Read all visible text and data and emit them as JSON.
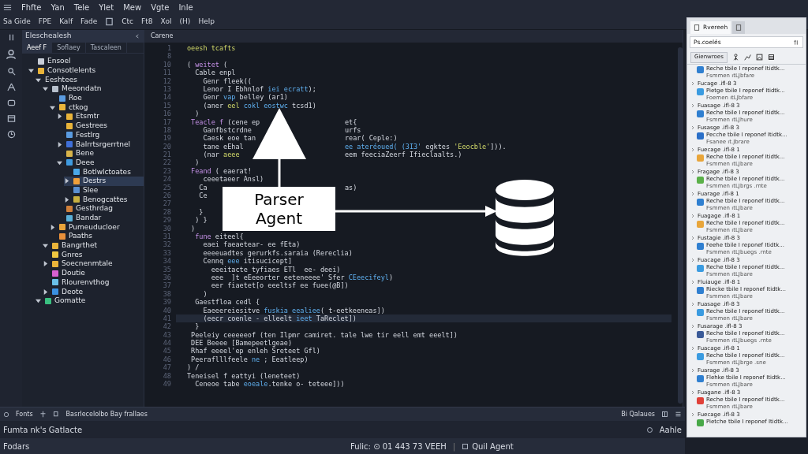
{
  "menu": [
    "Fhfte",
    "Yan",
    "Tele",
    "Ylet",
    "Mew",
    "Vgte",
    "Inle"
  ],
  "toolbar": [
    "Sa Gide",
    "FPE",
    "Kalf",
    "Fade",
    "Ctc",
    "Ft8",
    "Xol",
    "(H)",
    "Help"
  ],
  "explorer": {
    "title": "Eleschealesh",
    "tabs": [
      {
        "label": "Aeef F",
        "selected": true
      },
      {
        "label": "Soflaey",
        "selected": false
      },
      {
        "label": "Tascaleen",
        "selected": false
      }
    ],
    "tree": [
      {
        "label": "Ensoel",
        "color": "#c9ced8",
        "selected": false
      },
      {
        "label": "Consotlelents",
        "color": "#e9b43a",
        "expanded": true,
        "selected": false,
        "children": [
          {
            "label": "Eeshtees",
            "expanded": true,
            "selected": false,
            "children": [
              {
                "label": "Meeondatn",
                "color": "#b7c0cc",
                "expanded": true,
                "selected": false,
                "children": [
                  {
                    "label": "Roe",
                    "color": "#5a9be0",
                    "selected": false
                  },
                  {
                    "label": "ctkog",
                    "color": "#e9b43a",
                    "expanded": true,
                    "selected": false,
                    "children": [
                      {
                        "label": "Etsmtr",
                        "color": "#e9b43a",
                        "expanded": false,
                        "selected": false
                      },
                      {
                        "label": "Gestrees",
                        "color": "#e9b43a",
                        "selected": false
                      },
                      {
                        "label": "Festlrg",
                        "color": "#5a9be0",
                        "selected": false
                      },
                      {
                        "label": "Balrrtsrgerrtnel",
                        "color": "#3f6fd8",
                        "expanded": false,
                        "selected": false
                      },
                      {
                        "label": "Bene",
                        "color": "#d8b44a",
                        "selected": false
                      },
                      {
                        "label": "Deee",
                        "color": "#3f9be0",
                        "expanded": true,
                        "selected": false,
                        "children": [
                          {
                            "label": "Botlwlctoates",
                            "color": "#4aa8e8",
                            "selected": false
                          },
                          {
                            "label": "Destrs",
                            "color": "#f0a03a",
                            "expanded": false,
                            "selected": true
                          },
                          {
                            "label": "Slee",
                            "color": "#5a8fd0",
                            "selected": false
                          },
                          {
                            "label": "Benogcattes",
                            "color": "#c8b040",
                            "expanded": false,
                            "selected": false
                          }
                        ]
                      },
                      {
                        "label": "Gesthrdag",
                        "color": "#d0803a",
                        "selected": false
                      },
                      {
                        "label": "Bandar",
                        "color": "#5ab0d8",
                        "selected": false
                      }
                    ]
                  },
                  {
                    "label": "Pumeuducloer",
                    "color": "#e9a43a",
                    "expanded": false,
                    "selected": false
                  },
                  {
                    "label": "Paaths",
                    "color": "#e8903a",
                    "selected": false
                  }
                ]
              },
              {
                "label": "Bangrthet",
                "color": "#e9b43a",
                "expanded": true,
                "selected": false
              },
              {
                "label": "Gnres",
                "color": "#f0c840",
                "selected": false
              },
              {
                "label": "Soecnenmtale",
                "color": "#e9b43a",
                "expanded": false,
                "selected": false
              },
              {
                "label": "Doutie",
                "color": "#d860d0",
                "selected": false
              },
              {
                "label": "Rlourenvthog",
                "color": "#6ac0e8",
                "selected": false
              },
              {
                "label": "Deote",
                "color": "#3a90e0",
                "expanded": false,
                "selected": false
              }
            ]
          },
          {
            "label": "Gomatte",
            "color": "#3ac080",
            "expanded": true,
            "selected": false
          }
        ]
      }
    ]
  },
  "editor": {
    "tab": "Carene",
    "lines": [
      {
        "num": "1",
        "segs": [
          {
            "kind": "str",
            "text": "oeesh tcafts"
          }
        ]
      },
      {
        "num": "8"
      },
      {
        "num": "10",
        "segs": [
          {
            "kind": "plain",
            "text": "( "
          },
          {
            "kind": "kw",
            "text": "weitet"
          },
          {
            "kind": "plain",
            "text": " ("
          }
        ]
      },
      {
        "num": "11",
        "segs": [
          {
            "kind": "plain",
            "text": "  Cable enpl"
          }
        ]
      },
      {
        "num": "12",
        "segs": [
          {
            "kind": "plain",
            "text": "    Genr fleek(("
          }
        ]
      },
      {
        "num": "13",
        "segs": [
          {
            "kind": "plain",
            "text": "    Lenor I Ebhnlof "
          },
          {
            "kind": "fn",
            "text": "iei ecratt"
          },
          {
            "kind": "plain",
            "text": ");"
          }
        ]
      },
      {
        "num": "14",
        "segs": [
          {
            "kind": "plain",
            "text": "    Genr "
          },
          {
            "kind": "fn",
            "text": "vap"
          },
          {
            "kind": "plain",
            "text": " belley (ar1)"
          }
        ]
      },
      {
        "num": "15",
        "segs": [
          {
            "kind": "plain",
            "text": "    (aner "
          },
          {
            "kind": "str",
            "text": "eel"
          },
          {
            "kind": "fn",
            "text": " cokl eostwc"
          },
          {
            "kind": "plain",
            "text": " tcsd1)"
          }
        ]
      },
      {
        "num": "16",
        "segs": [
          {
            "kind": "plain",
            "text": "  )"
          }
        ]
      },
      {
        "num": "17",
        "segs": [
          {
            "kind": "kw",
            "text": " Teacle f"
          },
          {
            "kind": "plain",
            "text": " (cene ep"
          }
        ],
        "rest": [
          {
            "kind": "plain",
            "text": "et{"
          }
        ]
      },
      {
        "num": "18",
        "segs": [
          {
            "kind": "plain",
            "text": "    Ganfbstcrdne"
          }
        ],
        "rest": [
          {
            "kind": "plain",
            "text": "urfs"
          }
        ]
      },
      {
        "num": "19",
        "segs": [
          {
            "kind": "plain",
            "text": "    Caesk eoe tan"
          }
        ],
        "rest": [
          {
            "kind": "plain",
            "text": "rear( Ceple:)"
          }
        ]
      },
      {
        "num": "20",
        "segs": [
          {
            "kind": "plain",
            "text": "    tane eEhal"
          }
        ],
        "rest": [
          {
            "kind": "fn",
            "text": "ee ateréoued( (3I3' "
          },
          {
            "kind": "plain",
            "text": "egktes "
          },
          {
            "kind": "str",
            "text": "'Eeocble'"
          },
          {
            "kind": "plain",
            "text": "]))."
          }
        ]
      },
      {
        "num": "21",
        "segs": [
          {
            "kind": "plain",
            "text": "    (nar "
          },
          {
            "kind": "str",
            "text": "aeee"
          }
        ],
        "rest": [
          {
            "kind": "plain",
            "text": "eem feeciaZeerf Ifieclaalts.)"
          }
        ]
      },
      {
        "num": "22",
        "segs": [
          {
            "kind": "plain",
            "text": "  )"
          }
        ]
      },
      {
        "num": "23",
        "segs": [
          {
            "kind": "kw",
            "text": " Feand"
          },
          {
            "kind": "plain",
            "text": " ( eaerat!"
          }
        ]
      },
      {
        "num": "24",
        "segs": [
          {
            "kind": "plain",
            "text": "    ceeetaeer Ansl)"
          }
        ]
      },
      {
        "num": "25",
        "segs": [
          {
            "kind": "plain",
            "text": "   Ca"
          }
        ],
        "rest": [
          {
            "kind": "plain",
            "text": "as)"
          }
        ]
      },
      {
        "num": "26",
        "segs": [
          {
            "kind": "plain",
            "text": "   Ce"
          }
        ]
      },
      {
        "num": "27"
      },
      {
        "num": "28",
        "segs": [
          {
            "kind": "plain",
            "text": "   }"
          }
        ]
      },
      {
        "num": "29",
        "segs": [
          {
            "kind": "plain",
            "text": "  ) }"
          }
        ]
      },
      {
        "num": "30",
        "segs": [
          {
            "kind": "plain",
            "text": " )"
          }
        ]
      },
      {
        "num": "31",
        "segs": [
          {
            "kind": "kw",
            "text": "  fune"
          },
          {
            "kind": "plain",
            "text": " eiteel{"
          }
        ]
      },
      {
        "num": "32",
        "segs": [
          {
            "kind": "plain",
            "text": "    eaei faeaetear- ee fEta)"
          }
        ]
      },
      {
        "num": "33",
        "segs": [
          {
            "kind": "plain",
            "text": "    eeeeuadtes gerurkfs.saraia (Rereclia)"
          }
        ]
      },
      {
        "num": "34",
        "segs": [
          {
            "kind": "plain",
            "text": "    Cennq "
          },
          {
            "kind": "fn",
            "text": "eee"
          },
          {
            "kind": "plain",
            "text": " itisucicept]"
          }
        ]
      },
      {
        "num": "35",
        "segs": [
          {
            "kind": "plain",
            "text": "      eeeitacte tyfiaes ETl  ee- deei)"
          }
        ]
      },
      {
        "num": "36",
        "segs": [
          {
            "kind": "plain",
            "text": "      eee  ]t eEeeorter eeteneeee' Sfer "
          },
          {
            "kind": "fn",
            "text": "CEeecifeyl"
          },
          {
            "kind": "plain",
            "text": ")"
          }
        ]
      },
      {
        "num": "37",
        "segs": [
          {
            "kind": "plain",
            "text": "      eer fiaetet[o eeeltsf ee fuee(@B])"
          }
        ]
      },
      {
        "num": "38",
        "segs": [
          {
            "kind": "plain",
            "text": "    )"
          }
        ]
      },
      {
        "num": "39",
        "segs": [
          {
            "kind": "plain",
            "text": "  Gaestfloa cedl {"
          }
        ]
      },
      {
        "num": "40",
        "segs": [
          {
            "kind": "plain",
            "text": "    Eaeeereiesitve "
          },
          {
            "kind": "fn",
            "text": "fuskia eealiee"
          },
          {
            "kind": "plain",
            "text": "( t-eetkeeneas])"
          }
        ]
      },
      {
        "num": "41",
        "current": true,
        "segs": [
          {
            "kind": "plain",
            "text": "    (eecr coenle - elleelt "
          },
          {
            "kind": "fn",
            "text": "ieet"
          },
          {
            "kind": "plain",
            "text": " TaReclet])"
          }
        ]
      },
      {
        "num": "42",
        "segs": [
          {
            "kind": "plain",
            "text": "  }"
          }
        ]
      },
      {
        "num": "43",
        "segs": [
          {
            "kind": "plain",
            "text": " Peeleiy ceeeeeof (ten Ilpmr camiret. tale lwe tir eell emt eeelt])"
          }
        ]
      },
      {
        "num": "44",
        "segs": [
          {
            "kind": "plain",
            "text": " DEE Beeee [Bamepeetlgeae)"
          }
        ]
      },
      {
        "num": "45",
        "segs": [
          {
            "kind": "plain",
            "text": " Rhaf eeeel'ep enleh Sreteet Gfl)"
          }
        ]
      },
      {
        "num": "46",
        "segs": [
          {
            "kind": "plain",
            "text": " Peeraflllfeele "
          },
          {
            "kind": "fn",
            "text": "ne"
          },
          {
            "kind": "plain",
            "text": " ; Eeatleep)"
          }
        ]
      },
      {
        "num": "47",
        "segs": [
          {
            "kind": "plain",
            "text": ") /"
          }
        ]
      },
      {
        "num": "48",
        "segs": [
          {
            "kind": "plain",
            "text": "Teneisel f eattyi (leneteet)"
          }
        ]
      },
      {
        "num": "49",
        "segs": [
          {
            "kind": "plain",
            "text": "  Ceneoe tabe "
          },
          {
            "kind": "fn",
            "text": "eoeale"
          },
          {
            "kind": "plain",
            "text": ".tenke o- teteee]))"
          }
        ]
      }
    ]
  },
  "diagram": {
    "box": "Parser Agent"
  },
  "side_panel": {
    "tabs": [
      {
        "label": "Rvereeh",
        "selected": true
      },
      {
        "selected": false
      }
    ],
    "search": {
      "value": "Ps.coelés"
    },
    "filter_button": "Gienwroes",
    "items": [
      {
        "name": "Reche tbile I reponef Itidtk...",
        "detail": "Fsmmen ıtLJbfare",
        "color": "#2f7fd0"
      },
      {
        "title": "Fucage .ifl-8 3",
        "name": "Pietge tbile I reponef Itidtk...",
        "detail": "Foemen ıtLJbfare",
        "color": "#3a9be0"
      },
      {
        "title": "Fuasage .ifl-8 3",
        "name": "Reche tbile I reponef Itidtk...",
        "detail": "Fsmmen ıtLJhure",
        "color": "#2f7fd0"
      },
      {
        "title": "Fusasge .ifl-8 3",
        "name": "Pecche tbile I reponef Itidtk...",
        "detail": "Fsanee ıt.Jbrare",
        "color": "#2a6fc8"
      },
      {
        "title": "Fuecage .ifl-8 1",
        "name": "Reche tbile I reponef Itidtk...",
        "detail": "Fsmmen ıtLJbare",
        "color": "#e8a53a"
      },
      {
        "title": "Fragage .ifl-8 3",
        "name": "Reche tbile I reponef Itidtk...",
        "detail": "Fsmmen ıtLJbrgs .rnte",
        "color": "#5ab048"
      },
      {
        "title": "Fuarage .ifl-8 1",
        "name": "Reche tbile I reponef Itidtk...",
        "detail": "Fsmmen ıtLJbare",
        "color": "#2f7fd0"
      },
      {
        "title": "Fuagage .ifl-8 1",
        "name": "Reche tbile I reponef Itidtk...",
        "detail": "Fsmmen ıtLJbare",
        "color": "#e8a53a"
      },
      {
        "title": "Fustagie .ifl-8 3",
        "name": "Feehe tbile I reponef Itidtk...",
        "detail": "Fsmmen ıtLJbuegs .rnte",
        "color": "#2f7fd0"
      },
      {
        "title": "Fuacage .ifl-8 3",
        "name": "Reche tbile I reponef Itidtk...",
        "detail": "Fsmmen ıtLJbare",
        "color": "#3a9be0"
      },
      {
        "title": "Fluiauge .ifl-8 1",
        "name": "Riecke tbile I reponef Itidtk...",
        "detail": "Fsmmen ıtLJbare",
        "color": "#2f7fd0"
      },
      {
        "title": "Fuasage .ifl-8 3",
        "name": "Reche tbile I reponef Itidtk...",
        "detail": "Fsmmen ıtLJbare",
        "color": "#3a9be0"
      },
      {
        "title": "Fusarage .ifl-8 3",
        "name": "Reche tbile I reponef Itidtk...",
        "detail": "Fsmmen ıtLJbuegs .rnte",
        "color": "#3a5a98"
      },
      {
        "title": "Fuacage .ifl-8 1",
        "name": "Reche tbile I reponef Itidtk...",
        "detail": "Fsmmen ıtLJbrge .sne",
        "color": "#3a9be0"
      },
      {
        "title": "Fuarage .ifl-8 3",
        "name": "Flehke tbile I reponef Itidtk...",
        "detail": "Fsmmen ıtLJbare",
        "color": "#2f7fd0"
      },
      {
        "title": "Fuagane .ifl-8 3",
        "name": "Reche tbile I reponef Itidtk...",
        "detail": "Fsmmen ıtLJbare",
        "color": "#e04038"
      },
      {
        "title": "Fuecage .ifl-8 3",
        "name": "Pietche tbile I reponef Itidtk...",
        "color": "#48a848"
      }
    ]
  },
  "panel_bar": {
    "left": "Fonts",
    "middle": "Basrlecelolbo Bay frallaes",
    "right": "Bi Qalaues"
  },
  "status_bar": {
    "left": "Fumta nk's Gatlacte",
    "right": "Aahle"
  },
  "footer": {
    "left": "Fodars",
    "center": "Fulic: ⊙ 01 443 73 VEEH",
    "separator": "|",
    "agent": "Quil Agent"
  }
}
